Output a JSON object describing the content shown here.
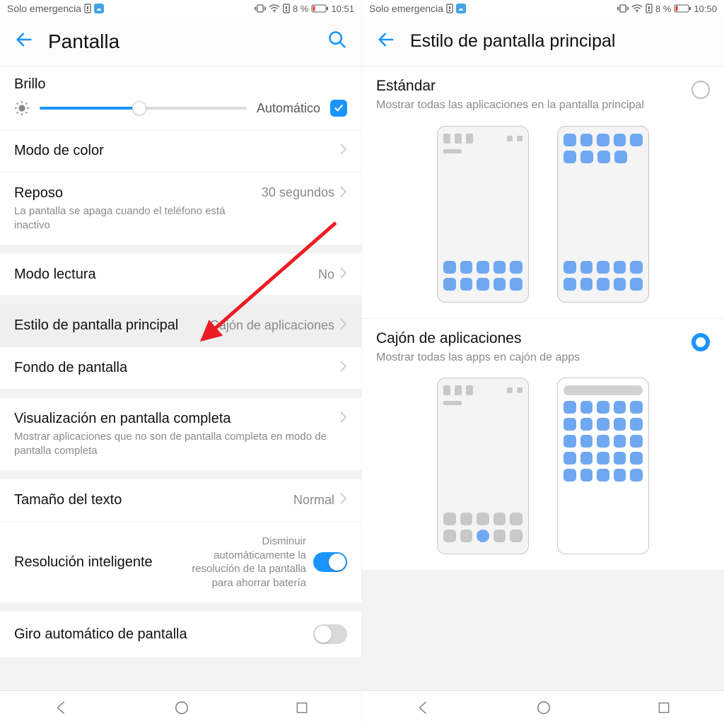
{
  "left": {
    "status": {
      "carrier": "Solo emergencia",
      "battery_pct": "8 %",
      "time": "10:51"
    },
    "header": {
      "title": "Pantalla"
    },
    "brightness": {
      "title": "Brillo",
      "auto_label": "Automático",
      "auto_checked": true,
      "slider_pct": 48
    },
    "items": {
      "color_mode": {
        "label": "Modo de color"
      },
      "sleep": {
        "label": "Reposo",
        "desc": "La pantalla se apaga cuando el teléfono está inactivo",
        "value": "30 segundos"
      },
      "reading_mode": {
        "label": "Modo lectura",
        "value": "No"
      },
      "home_style": {
        "label": "Estilo de pantalla principal",
        "value": "Cajón de aplicaciones"
      },
      "wallpaper": {
        "label": "Fondo de pantalla"
      },
      "fullscreen": {
        "label": "Visualización en pantalla completa",
        "desc": "Mostrar aplicaciones que no son de pantalla completa en modo de pantalla completa"
      },
      "text_size": {
        "label": "Tamaño del texto",
        "value": "Normal"
      },
      "smart_res": {
        "label": "Resolución inteligente",
        "desc": "Disminuir automáticamente la resolución de la pantalla para ahorrar batería",
        "on": true
      },
      "auto_rotate": {
        "label": "Giro automático de pantalla",
        "on": false
      }
    }
  },
  "right": {
    "status": {
      "carrier": "Solo emergencia",
      "battery_pct": "8 %",
      "time": "10:50"
    },
    "header": {
      "title": "Estilo de pantalla principal"
    },
    "options": {
      "standard": {
        "title": "Estándar",
        "desc": "Mostrar todas las aplicaciones en la pantalla principal",
        "selected": false
      },
      "drawer": {
        "title": "Cajón de aplicaciones",
        "desc": "Mostrar todas las apps en cajón de apps",
        "selected": true
      }
    }
  },
  "colors": {
    "accent": "#1a95ff",
    "arrow": "#ec1c24"
  }
}
